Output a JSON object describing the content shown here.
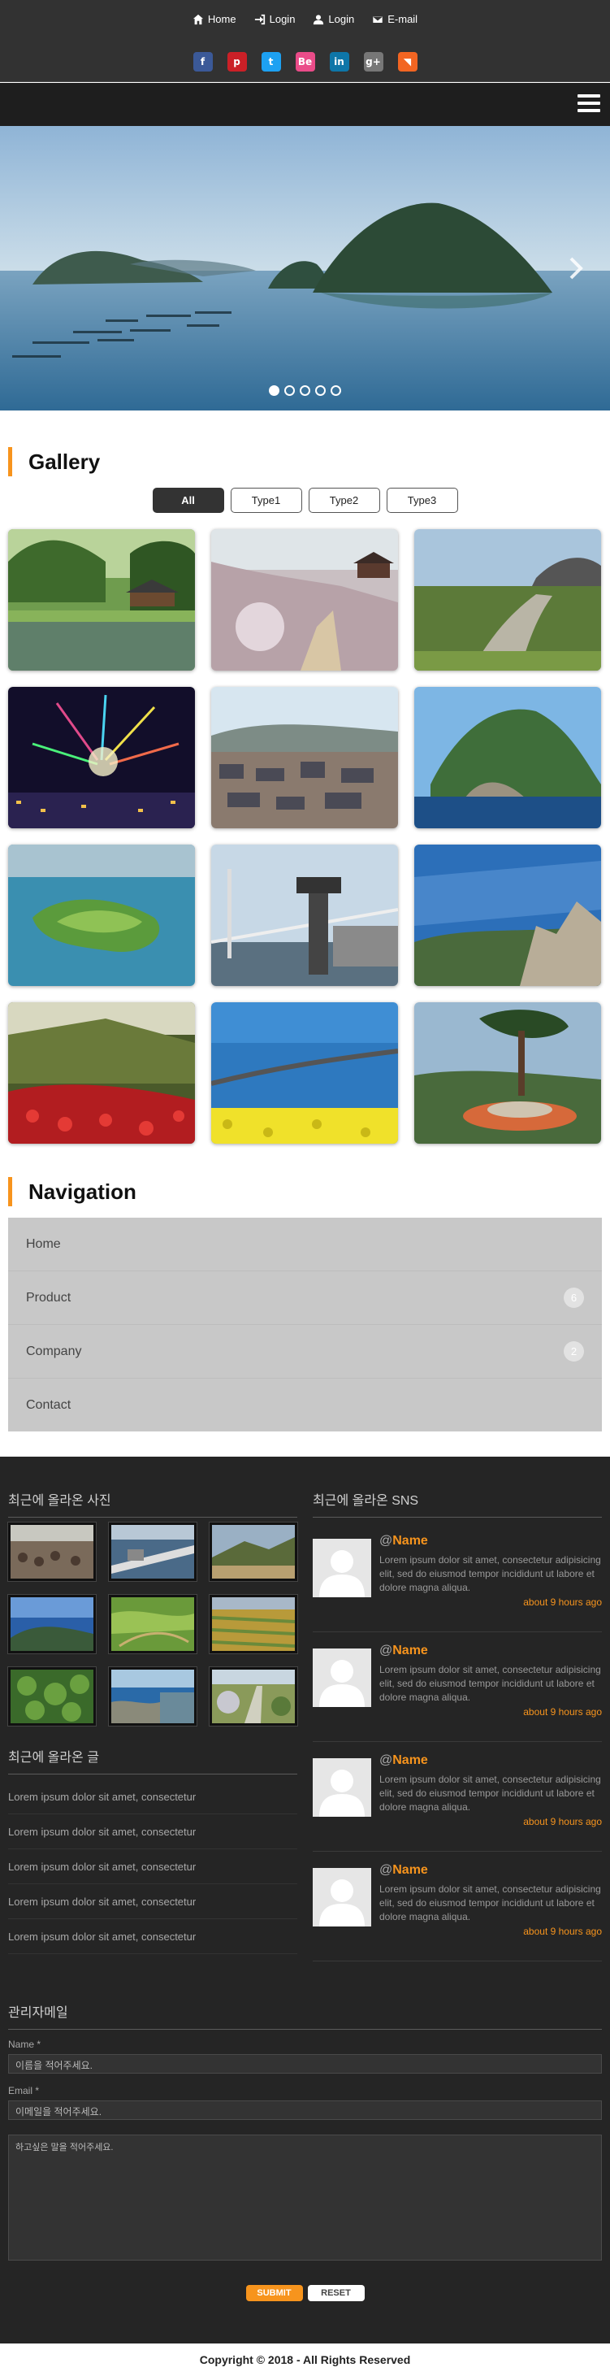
{
  "header": {
    "links": [
      {
        "label": "Home",
        "icon": "home-icon"
      },
      {
        "label": "Login",
        "icon": "sign-in-icon"
      },
      {
        "label": "Login",
        "icon": "user-icon"
      },
      {
        "label": "E-mail",
        "icon": "envelope-icon"
      }
    ],
    "social": [
      {
        "icon": "facebook-icon",
        "glyph": "f",
        "color": "#3b5998"
      },
      {
        "icon": "pinterest-icon",
        "glyph": "p",
        "color": "#cb2027"
      },
      {
        "icon": "twitter-icon",
        "glyph": "t",
        "color": "#1da1f2"
      },
      {
        "icon": "behance-icon",
        "glyph": "Be",
        "color": "#ea4c89"
      },
      {
        "icon": "linkedin-icon",
        "glyph": "in",
        "color": "#0e76a8"
      },
      {
        "icon": "google-plus-icon",
        "glyph": "g+",
        "color": "#777777"
      },
      {
        "icon": "rss-icon",
        "glyph": "◥",
        "color": "#f26522"
      }
    ]
  },
  "slider": {
    "active_index": 0,
    "dot_count": 5
  },
  "gallery": {
    "title": "Gallery",
    "filters": [
      "All",
      "Type1",
      "Type2",
      "Type3"
    ],
    "active_filter": "All"
  },
  "navigation": {
    "title": "Navigation",
    "items": [
      {
        "label": "Home",
        "count": ""
      },
      {
        "label": "Product",
        "count": "6"
      },
      {
        "label": "Company",
        "count": "2"
      },
      {
        "label": "Contact",
        "count": ""
      }
    ]
  },
  "footer": {
    "photos_title": "최근에 올라온 사진",
    "posts_title": "최근에 올라온 글",
    "posts": [
      "Lorem ipsum dolor sit amet, consectetur",
      "Lorem ipsum dolor sit amet, consectetur",
      "Lorem ipsum dolor sit amet, consectetur",
      "Lorem ipsum dolor sit amet, consectetur",
      "Lorem ipsum dolor sit amet, consectetur"
    ],
    "sns_title": "최근에 올라온 SNS",
    "sns": [
      {
        "name": "Name",
        "text": "Lorem ipsum dolor sit amet, consectetur adipisicing elit, sed do eiusmod tempor incididunt ut labore et dolore magna aliqua.",
        "time": "about 9 hours ago"
      },
      {
        "name": "Name",
        "text": "Lorem ipsum dolor sit amet, consectetur adipisicing elit, sed do eiusmod tempor incididunt ut labore et dolore magna aliqua.",
        "time": "about 9 hours ago"
      },
      {
        "name": "Name",
        "text": "Lorem ipsum dolor sit amet, consectetur adipisicing elit, sed do eiusmod tempor incididunt ut labore et dolore magna aliqua.",
        "time": "about 9 hours ago"
      },
      {
        "name": "Name",
        "text": "Lorem ipsum dolor sit amet, consectetur adipisicing elit, sed do eiusmod tempor incididunt ut labore et dolore magna aliqua.",
        "time": "about 9 hours ago"
      }
    ],
    "contact": {
      "title": "관리자메일",
      "name_label": "Name *",
      "name_placeholder": "이름을 적어주세요.",
      "email_label": "Email *",
      "email_placeholder": "이메일을 적어주세요.",
      "message_placeholder": "하고싶은 말을 적어주세요.",
      "submit": "SUBMIT",
      "reset": "RESET"
    },
    "copyright": "Copyright © 2018 - All Rights Reserved"
  },
  "colors": {
    "accent": "#f7941d",
    "dark": "#252525"
  }
}
